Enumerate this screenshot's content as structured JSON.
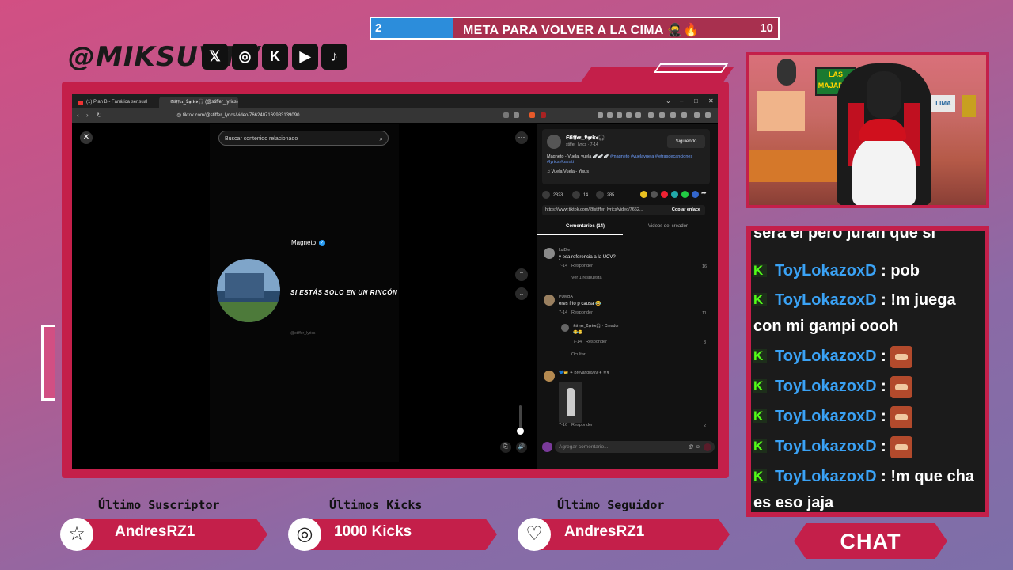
{
  "goal": {
    "start": "2",
    "end": "10",
    "title": "META PARA VOLVER A LA CIMA 🥷🔥",
    "progress": 0.2
  },
  "handle": "@MIKSUVT /",
  "socials": [
    {
      "name": "x",
      "glyph": "𝕏"
    },
    {
      "name": "instagram",
      "glyph": "◎"
    },
    {
      "name": "kick",
      "glyph": "K"
    },
    {
      "name": "youtube",
      "glyph": "▶"
    },
    {
      "name": "tiktok",
      "glyph": "♪"
    }
  ],
  "browser": {
    "tab1": "(1) Plan B - Fanática sensual (Letra)",
    "tab2": "𝕾𝖙𝖎𝖋𝖋𝖊𝖗_𝕷𝖞𝖗𝖎𝖈𝖘🎧 (@stiffer_lyrics)",
    "url": "tiktok.com/@stiffer_lyrics/video/7662407169983139090"
  },
  "tiktok": {
    "search_placeholder": "Buscar contenido relacionado",
    "video_name": "Magneto",
    "lyric": "SI ESTÁS SOLO EN UN RINCÓN",
    "video_handle": "@stiffer_lyrics",
    "creator_name": "𝕾𝖙𝖎𝖋𝖋𝖊𝖗_𝕷𝖞𝖗𝖎𝖈𝖘🎧",
    "creator_sub": "stiffer_lyrics · 7-14",
    "follow_label": "Siguiendo",
    "description": "Magneto - Vuela, vuela 🪽🪽🪽",
    "tags": "#magneto #vuelavuela #letrasdecanciones #lyrics #parati",
    "song": "♫ Vuela Vuela - Yisus",
    "likes": "2823",
    "comments": "14",
    "saves": "285",
    "link": "https://www.tiktok.com/@stiffer_lyrics/video/7662...",
    "copy_label": "Copiar enlace",
    "tab_comments": "Comentarios (14)",
    "tab_videos": "Videos del creador",
    "add_comment": "Agregar comentario...",
    "comments_list": [
      {
        "user": "LuiDie",
        "text": "y esa referencia a la UCV?",
        "date": "7-14",
        "reply": "Responder",
        "likes": "16",
        "more": "Ver 1 respuesta"
      },
      {
        "user": "PUMBA",
        "text": "eres frio p causa 😂",
        "date": "7-14",
        "reply": "Responder",
        "likes": "11"
      },
      {
        "user": "𝕾𝖙𝖎𝖋𝖋𝖊𝖗_𝕷𝖞𝖗𝖎𝖈𝖘🎧 · Creador",
        "text": "😂😂",
        "date": "7-14",
        "reply": "Responder",
        "likes": "3",
        "more": "Ocultar"
      },
      {
        "user": "💙👑 ✈ Breyangg999 ✈ ❄❄",
        "date": "7-16",
        "reply": "Responder",
        "likes": "2"
      }
    ]
  },
  "chat": {
    "messages": [
      {
        "text": "sera el pero juran que si"
      },
      {
        "user": "ToyLokazoxD",
        "text": ": pob"
      },
      {
        "user": "ToyLokazoxD",
        "text": ": !m juega con mi gampi oooh"
      },
      {
        "user": "ToyLokazoxD",
        "text": ":",
        "emote": true
      },
      {
        "user": "ToyLokazoxD",
        "text": ":",
        "emote": true
      },
      {
        "user": "ToyLokazoxD",
        "text": ":",
        "emote": true
      },
      {
        "user": "ToyLokazoxD",
        "text": ":",
        "emote": true
      },
      {
        "user": "ToyLokazoxD",
        "text": ": !m que cha es eso jaja"
      }
    ],
    "button": "CHAT"
  },
  "webcam": {
    "sign": "LAS MAJADAS",
    "lima": "LIMA"
  },
  "stats": [
    {
      "title": "Último Suscriptor",
      "value": "AndresRZ1"
    },
    {
      "title": "Últimos Kicks",
      "value": "1000 Kicks"
    },
    {
      "title": "Último Seguidor",
      "value": "AndresRZ1"
    }
  ],
  "colors": {
    "accent": "#c41f4a",
    "goal_fill": "#2c8ddb",
    "chat_user": "#3aa2f5",
    "kick_green": "#53fc18"
  }
}
